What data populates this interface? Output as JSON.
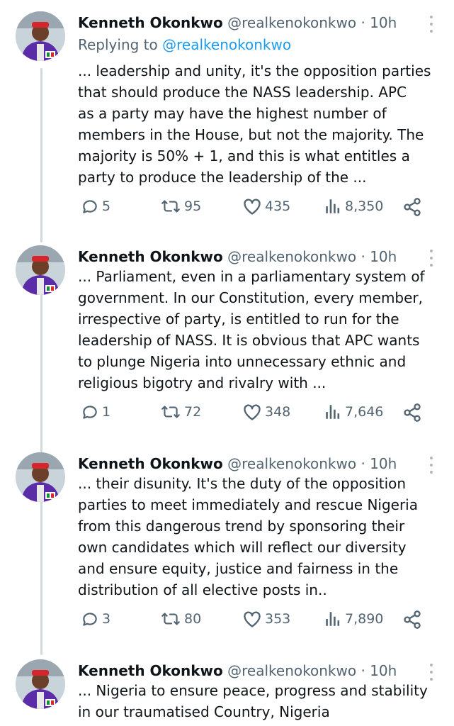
{
  "icons": {
    "reply": "reply-icon",
    "retweet": "retweet-icon",
    "like": "heart-icon",
    "views": "views-icon",
    "share": "share-icon",
    "more": "more-icon"
  },
  "colors": {
    "link": "#1d9bf0",
    "secondary": "#536471",
    "thread_line": "#cfd9de"
  },
  "tweets": [
    {
      "name": "Kenneth Okonkwo",
      "handle": "@realkenokonkwo",
      "separator": "·",
      "time": "10h",
      "replying_label": "Replying to",
      "replying_handle": "@realkenokonkwo",
      "text": "... leadership and unity, it's the opposition parties\nthat should produce the NASS leadership. APC\nas a party may have the highest number of\nmembers in the House, but not the majority. The\nmajority is 50% + 1, and this is what entitles a\nparty to produce the leadership of the ...",
      "replies": "5",
      "retweets": "95",
      "likes": "435",
      "views": "8,350"
    },
    {
      "name": "Kenneth Okonkwo",
      "handle": "@realkenokonkwo",
      "separator": "·",
      "time": "10h",
      "text": "... Parliament, even in a parliamentary system of\ngovernment. In our Constitution, every member,\nirrespective of party, is entitled to run for the\nleadership of NASS. It is obvious that APC wants\nto plunge Nigeria into unnecessary ethnic and\nreligious bigotry and rivalry with ...",
      "replies": "1",
      "retweets": "72",
      "likes": "348",
      "views": "7,646"
    },
    {
      "name": "Kenneth Okonkwo",
      "handle": "@realkenokonkwo",
      "separator": "·",
      "time": "10h",
      "text": "... their disunity. It's the duty of the opposition\nparties to meet immediately and rescue Nigeria\nfrom this dangerous trend by sponsoring their\nown candidates which will reflect our diversity\nand ensure equity, justice and fairness in the\ndistribution of all elective posts in..",
      "replies": "3",
      "retweets": "80",
      "likes": "353",
      "views": "7,890"
    },
    {
      "name": "Kenneth Okonkwo",
      "handle": "@realkenokonkwo",
      "separator": "·",
      "time": "10h",
      "text": "... Nigeria to ensure peace, progress and stability\nin our traumatised Country, Nigeria"
    }
  ]
}
